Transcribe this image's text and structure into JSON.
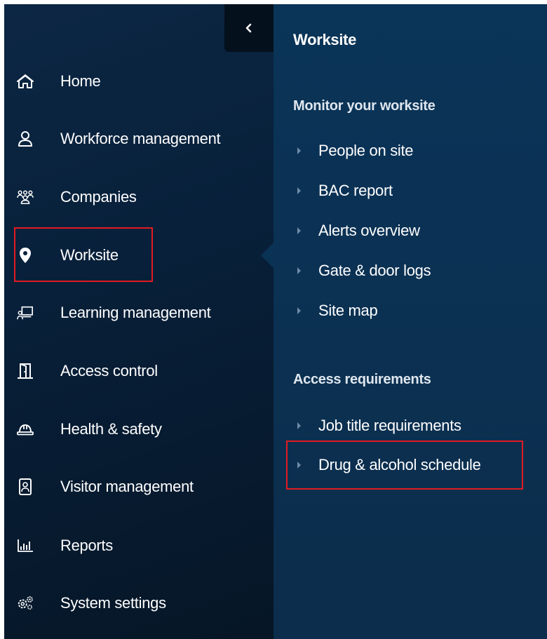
{
  "sidebar": {
    "items": [
      {
        "label": "Home",
        "icon": "home-icon"
      },
      {
        "label": "Workforce management",
        "icon": "user-icon"
      },
      {
        "label": "Companies",
        "icon": "group-icon"
      },
      {
        "label": "Worksite",
        "icon": "location-pin-icon"
      },
      {
        "label": "Learning management",
        "icon": "learning-icon"
      },
      {
        "label": "Access control",
        "icon": "door-icon"
      },
      {
        "label": "Health & safety",
        "icon": "hard-hat-icon"
      },
      {
        "label": "Visitor management",
        "icon": "badge-icon"
      },
      {
        "label": "Reports",
        "icon": "bar-chart-icon"
      },
      {
        "label": "System settings",
        "icon": "gears-icon"
      }
    ],
    "active": "Worksite"
  },
  "panel": {
    "title": "Worksite",
    "sections": [
      {
        "heading": "Monitor your worksite",
        "items": [
          "People on site",
          "BAC report",
          "Alerts overview",
          "Gate & door logs",
          "Site map"
        ]
      },
      {
        "heading": "Access requirements",
        "items": [
          "Job title requirements",
          "Drug & alcohol schedule"
        ]
      }
    ]
  },
  "colors": {
    "sidebar_bg": "#08203a",
    "panel_bg": "#0b3153",
    "highlight": "#e01b22",
    "text": "#ffffff"
  }
}
